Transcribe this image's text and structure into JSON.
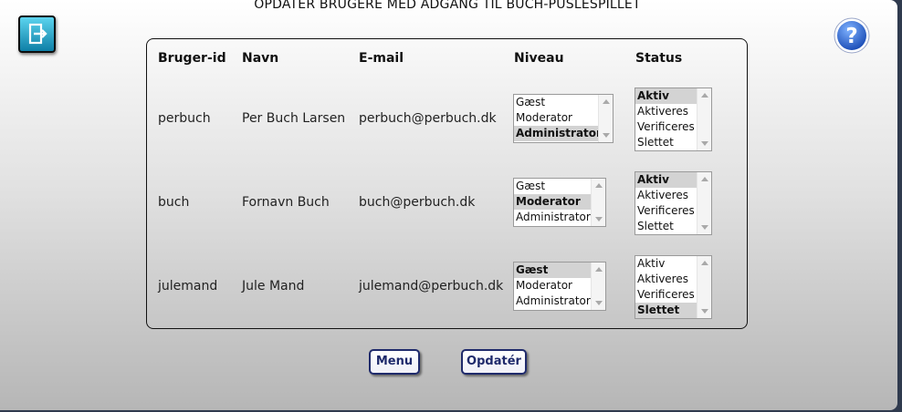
{
  "page": {
    "title": "OPDATER BRUGERE MED ADGANG TIL BUCH-PUSLESPILLET"
  },
  "table": {
    "headers": [
      "Bruger-id",
      "Navn",
      "E-mail",
      "Niveau",
      "Status"
    ],
    "rows": [
      {
        "id": "perbuch",
        "name": "Per Buch Larsen",
        "email": "perbuch@perbuch.dk",
        "niveau": [
          "Gæst",
          "Moderator",
          "Administrator"
        ],
        "niveau_selected": "Administrator",
        "status": [
          "Aktiv",
          "Aktiveres",
          "Verificeres",
          "Slettet"
        ],
        "status_selected": "Aktiv"
      },
      {
        "id": "buch",
        "name": "Fornavn Buch",
        "email": "buch@perbuch.dk",
        "niveau": [
          "Gæst",
          "Moderator",
          "Administrator"
        ],
        "niveau_selected": "Moderator",
        "status": [
          "Aktiv",
          "Aktiveres",
          "Verificeres",
          "Slettet"
        ],
        "status_selected": "Aktiv"
      },
      {
        "id": "julemand",
        "name": "Jule Mand",
        "email": "julemand@perbuch.dk",
        "niveau": [
          "Gæst",
          "Moderator",
          "Administrator"
        ],
        "niveau_selected": "Gæst",
        "status": [
          "Aktiv",
          "Aktiveres",
          "Verificeres",
          "Slettet"
        ],
        "status_selected": "Slettet"
      }
    ]
  },
  "buttons": {
    "menu": "Menu",
    "update": "Opdatér"
  },
  "icons": {
    "exit": "exit-icon",
    "help": "help-icon"
  },
  "colors": {
    "accent": "#1f2a6b",
    "exit_button": "#0e7fa6",
    "help_button": "#1d5fd0"
  }
}
